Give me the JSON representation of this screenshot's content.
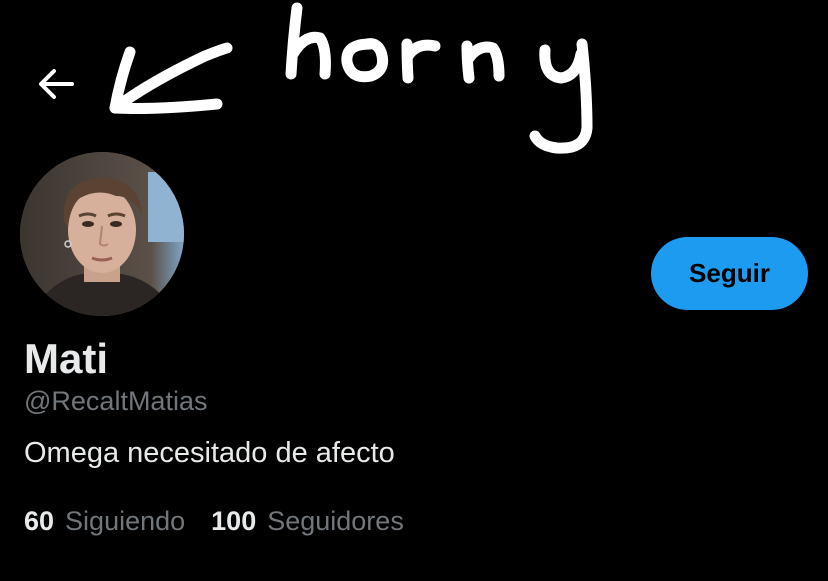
{
  "header": {
    "back_icon": "arrow-left-icon",
    "annotation_text": "horny"
  },
  "profile": {
    "display_name": "Mati",
    "handle": "@RecaltMatias",
    "bio": "Omega necesitado de afecto",
    "avatar": "profile-photo"
  },
  "actions": {
    "follow_label": "Seguir"
  },
  "stats": {
    "following_count": "60",
    "following_label": "Siguiendo",
    "followers_count": "100",
    "followers_label": "Seguidores"
  },
  "colors": {
    "background": "#000000",
    "accent": "#1d9bf0",
    "primary_text": "#e7e9ea",
    "secondary_text": "#71767b",
    "scribble": "#ffffff"
  }
}
